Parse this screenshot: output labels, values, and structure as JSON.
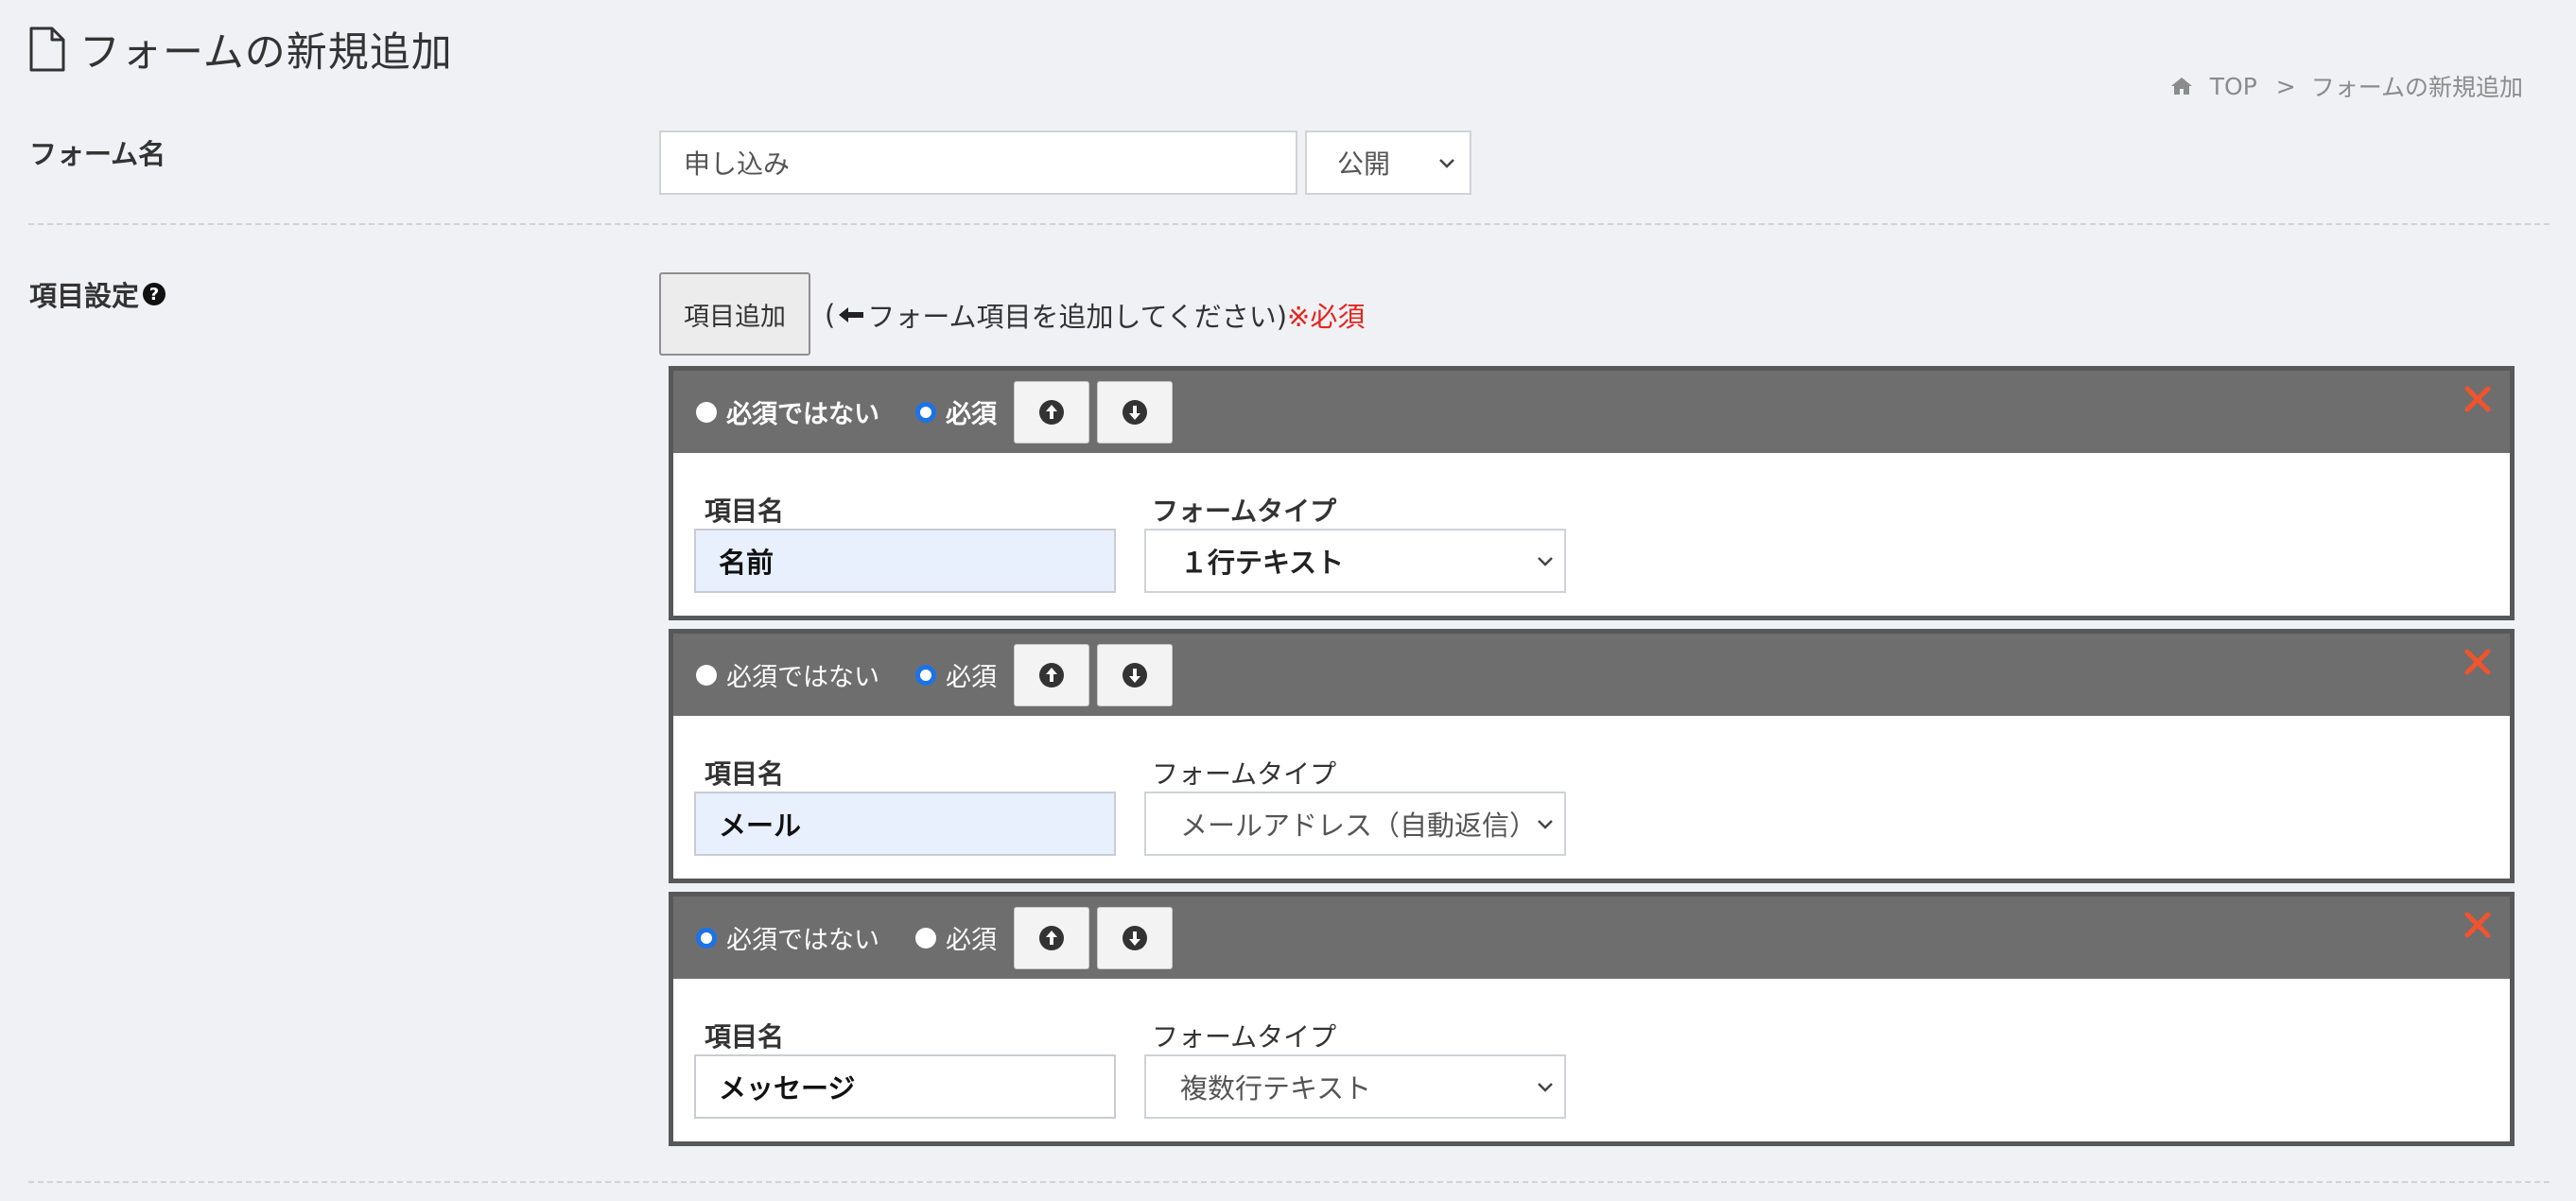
{
  "page": {
    "title": "フォームの新規追加"
  },
  "breadcrumb": {
    "home": "TOP",
    "separator": ">",
    "current": "フォームの新規追加"
  },
  "form_name": {
    "label": "フォーム名",
    "value": "申し込み",
    "status": "公開"
  },
  "items_section": {
    "label": "項目設定",
    "help_glyph": "?",
    "add_button": "項目追加",
    "hint_open": "(",
    "hint_text": "フォーム項目を追加してください)",
    "hint_required": "※必須"
  },
  "items": [
    {
      "opt_not_required": "必須ではない",
      "opt_required": "必須",
      "selected": "required",
      "name_label": "項目名",
      "name_value": "名前",
      "type_label": "フォームタイプ",
      "type_value": "１行テキスト"
    },
    {
      "opt_not_required": "必須ではない",
      "opt_required": "必須",
      "selected": "required",
      "name_label": "項目名",
      "name_value": "メール",
      "type_label": "フォームタイプ",
      "type_value": "メールアドレス（自動返信）"
    },
    {
      "opt_not_required": "必須ではない",
      "opt_required": "必須",
      "selected": "not_required",
      "name_label": "項目名",
      "name_value": "メッセージ",
      "type_label": "フォームタイプ",
      "type_value": "複数行テキスト"
    }
  ],
  "icons": {
    "title": "file-outline-icon",
    "home": "home-icon",
    "help": "question-circle-icon",
    "hint": "arrow-left-icon",
    "up": "arrow-circle-up-icon",
    "down": "arrow-circle-down-icon",
    "close": "close-icon",
    "chevron": "chevron-down-icon"
  },
  "colors": {
    "background": "#f0f1f5",
    "card_header": "#6e6e6e",
    "required_text": "#e2261f",
    "radio_selected": "#1a73e8",
    "close": "#f0542d",
    "filled_input": "#e8f0fe"
  }
}
